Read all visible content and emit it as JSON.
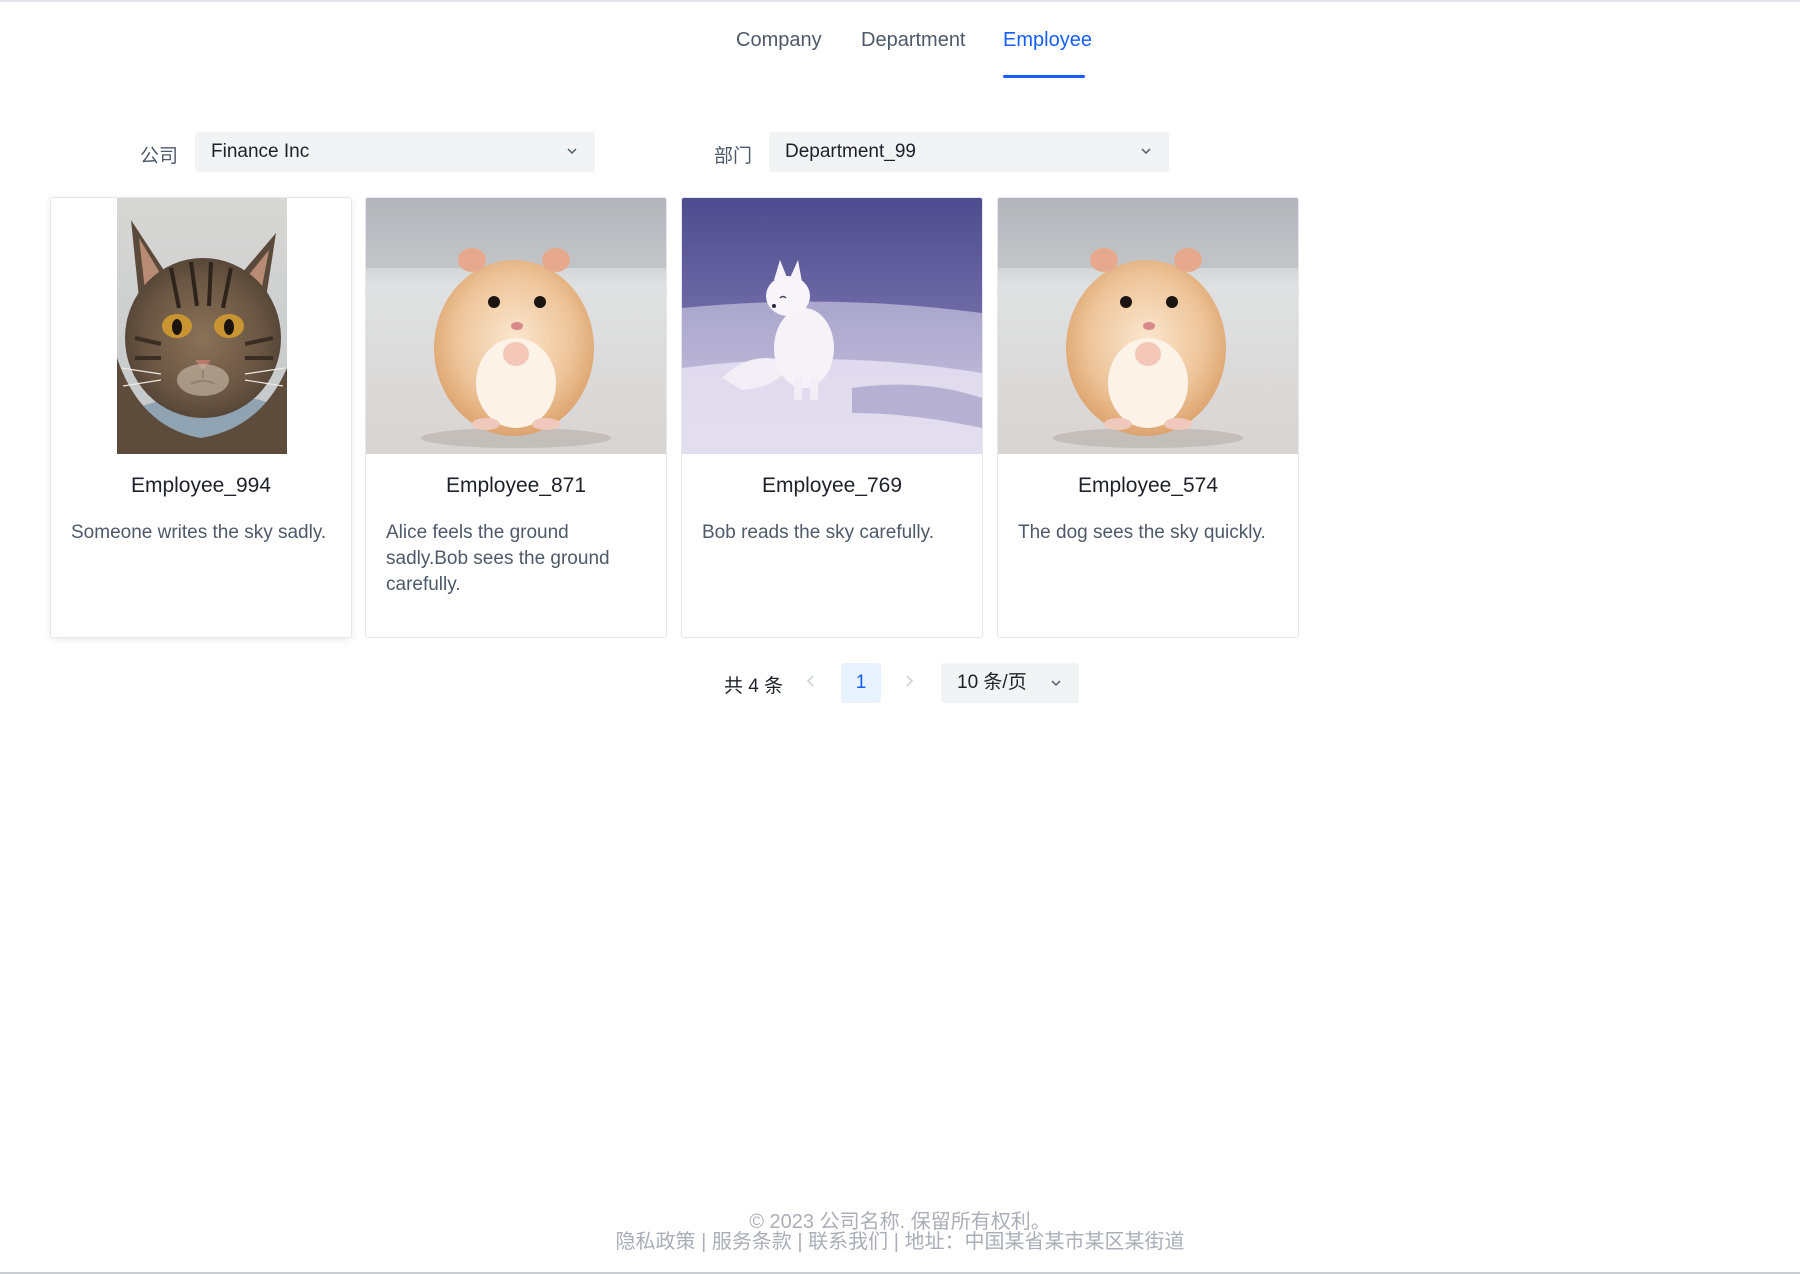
{
  "tabs": [
    {
      "label": "Company",
      "active": false
    },
    {
      "label": "Department",
      "active": false
    },
    {
      "label": "Employee",
      "active": true
    }
  ],
  "filters": {
    "company": {
      "label": "公司",
      "value": "Finance Inc"
    },
    "department": {
      "label": "部门",
      "value": "Department_99"
    }
  },
  "employees": [
    {
      "name": "Employee_994",
      "description": "Someone writes the sky sadly.",
      "image": "cat"
    },
    {
      "name": "Employee_871",
      "description": "Alice feels the ground sadly.Bob sees the ground carefully.",
      "image": "hamster"
    },
    {
      "name": "Employee_769",
      "description": "Bob reads the sky carefully.",
      "image": "arctic-fox"
    },
    {
      "name": "Employee_574",
      "description": "The dog sees the sky quickly.",
      "image": "hamster"
    }
  ],
  "pagination": {
    "total_text": "共 4 条",
    "current_page": "1",
    "page_size": "10 条/页"
  },
  "footer": {
    "copyright": "© 2023 公司名称. 保留所有权利。",
    "links": "隐私政策 | 服务条款 | 联系我们 | 地址：中国某省某市某区某街道"
  },
  "colors": {
    "accent": "#165dff",
    "select_bg": "#f2f3f5",
    "page_active_bg": "#e8f3ff"
  }
}
